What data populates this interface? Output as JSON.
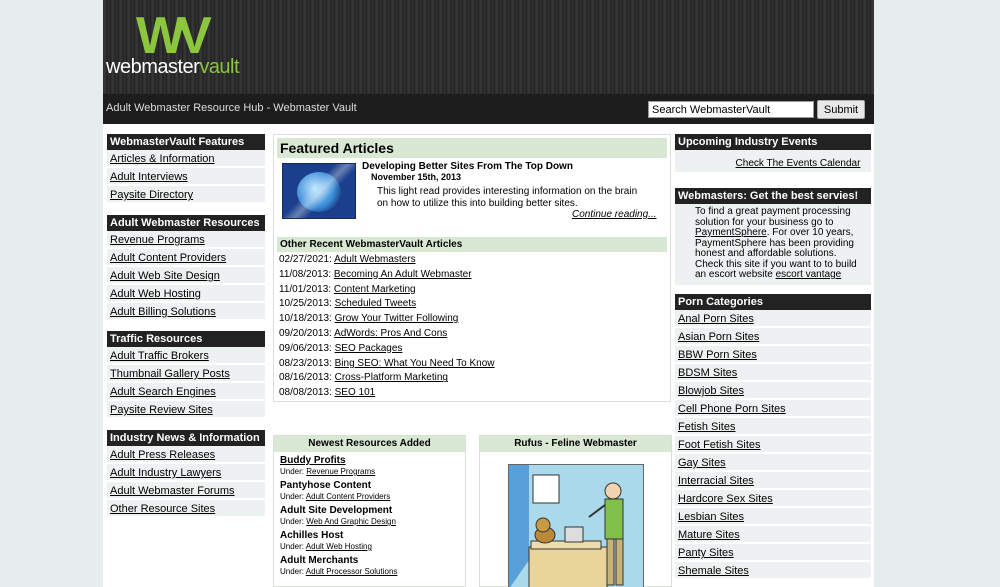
{
  "header": {
    "logo_mark": "WV",
    "logo_word_a": "webmaster",
    "logo_word_b": "vault",
    "tagline": "Adult Webmaster Resource Hub - Webmaster Vault",
    "search_value": "Search WebmasterVault",
    "search_button": "Submit"
  },
  "left": [
    {
      "title": "WebmasterVault Features",
      "items": [
        "Articles & Information",
        "Adult Interviews",
        "Paysite Directory"
      ]
    },
    {
      "title": "Adult Webmaster Resources",
      "items": [
        "Revenue Programs",
        "Adult Content Providers",
        "Adult Web Site Design",
        "Adult Web Hosting",
        "Adult Billing Solutions"
      ]
    },
    {
      "title": "Traffic Resources",
      "items": [
        "Adult Traffic Brokers",
        "Thumbnail Gallery Posts",
        "Adult Search Engines",
        "Paysite Review Sites"
      ]
    },
    {
      "title": "Industry News & Information",
      "items": [
        "Adult Press Releases",
        "Adult Industry Lawyers",
        "Adult Webmaster Forums",
        "Other Resource Sites"
      ]
    }
  ],
  "featured": {
    "heading": "Featured Articles",
    "title": "Developing Better Sites From The Top Down",
    "date": "November 15th, 2013",
    "description": "This light read provides interesting information on the brain on how to utilize this into building better sites.",
    "more": "Continue reading..."
  },
  "other": {
    "heading": "Other Recent WebmasterVault Articles",
    "items": [
      {
        "date": "02/27/2021:",
        "title": "Adult Webmasters"
      },
      {
        "date": "11/08/2013:",
        "title": "Becoming An Adult Webmaster"
      },
      {
        "date": "11/01/2013:",
        "title": "Content Marketing"
      },
      {
        "date": "10/25/2013:",
        "title": "Scheduled Tweets"
      },
      {
        "date": "10/18/2013:",
        "title": "Grow Your Twitter Following"
      },
      {
        "date": "09/20/2013:",
        "title": "AdWords: Pros And Cons"
      },
      {
        "date": "09/06/2013:",
        "title": "SEO Packages"
      },
      {
        "date": "08/23/2013:",
        "title": "Bing SEO: What You Need To Know"
      },
      {
        "date": "08/16/2013:",
        "title": "Cross-Platform Marketing"
      },
      {
        "date": "08/08/2013:",
        "title": "SEO 101"
      }
    ]
  },
  "resources": {
    "heading": "Newest Resources Added",
    "under_label": "Under:",
    "items": [
      {
        "name": "Buddy Profits",
        "under": "Revenue Programs"
      },
      {
        "name": "Pantyhose Content",
        "under": "Adult Content Providers"
      },
      {
        "name": "Adult Site Development",
        "under": "Web And Graphic Design"
      },
      {
        "name": "Achilles Host",
        "under": "Adult Web Hosting"
      },
      {
        "name": "Adult Merchants",
        "under": "Adult Processor Solutions"
      }
    ]
  },
  "rufus": {
    "heading": "Rufus - Feline Webmaster"
  },
  "events": {
    "heading": "Upcoming Industry Events",
    "link": "Check The Events Calendar"
  },
  "webmasters": {
    "heading": "Webmasters: Get the best servies!",
    "p1": "To find a great payment processing solution for your business go to",
    "link1": "PaymentSphere",
    "p2": ". For over 10 years, PaymentSphere has been providing honest and affordable solutions.",
    "p3": "Check this site if you want to to build an escort website",
    "link2": "escort vantage"
  },
  "porn": {
    "heading": "Porn Categories",
    "items": [
      "Anal Porn Sites",
      "Asian Porn Sites",
      "BBW Porn Sites",
      "BDSM Sites",
      "Blowjob Sites",
      "Cell Phone Porn Sites",
      "Fetish Sites",
      "Foot Fetish Sites",
      "Gay Sites",
      "Interracial Sites",
      "Hardcore Sex Sites",
      "Lesbian Sites",
      "Mature Sites",
      "Panty Sites",
      "Shemale Sites"
    ]
  }
}
